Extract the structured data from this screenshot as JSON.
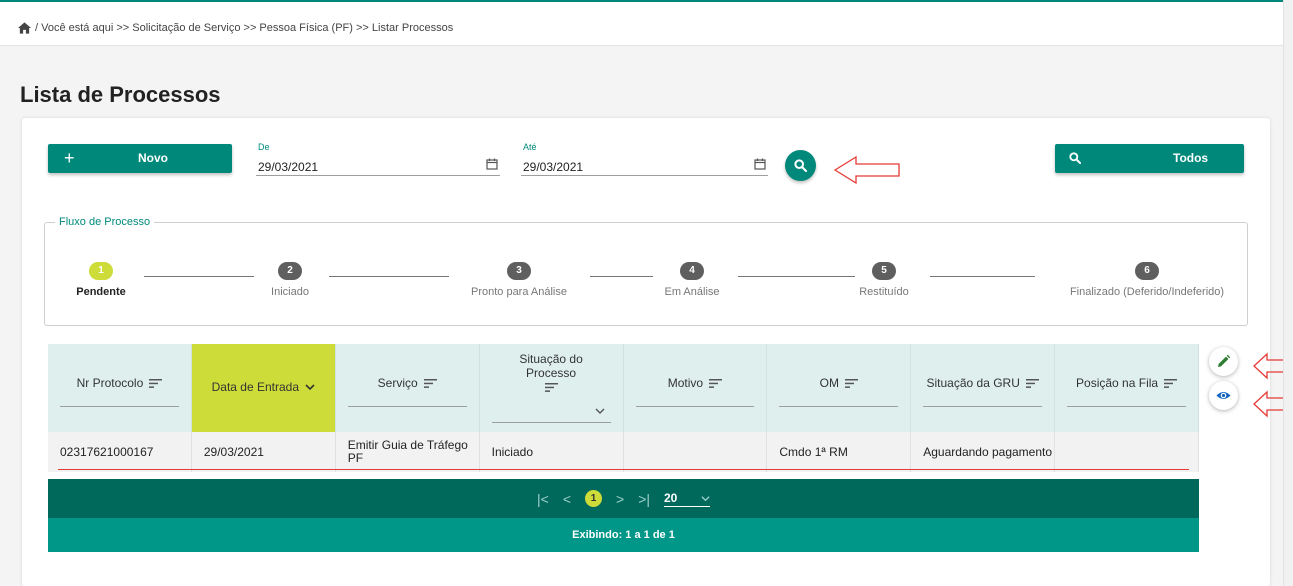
{
  "breadcrumb": {
    "text": "/ Você está aqui >> Solicitação de Serviço >> Pessoa Física (PF) >> Listar Processos",
    "icon": "home-icon"
  },
  "page": {
    "title": "Lista de Processos"
  },
  "toolbar": {
    "novo_icon": "+",
    "novo_label": "Novo",
    "todos_label": "Todos",
    "de_label": "De",
    "de_value": "29/03/2021",
    "ate_label": "Até",
    "ate_value": "29/03/2021"
  },
  "fluxo": {
    "legend": "Fluxo de Processo",
    "steps": [
      {
        "num": "1",
        "label": "Pendente",
        "active": true
      },
      {
        "num": "2",
        "label": "Iniciado",
        "active": false
      },
      {
        "num": "3",
        "label": "Pronto para Análise",
        "active": false
      },
      {
        "num": "4",
        "label": "Em Análise",
        "active": false
      },
      {
        "num": "5",
        "label": "Restituído",
        "active": false
      },
      {
        "num": "6",
        "label": "Finalizado (Deferido/Indeferido)",
        "active": false
      }
    ]
  },
  "table": {
    "columns": [
      {
        "label": "Nr Protocolo"
      },
      {
        "label": "Data de Entrada",
        "sorted": true
      },
      {
        "label": "Serviço"
      },
      {
        "label": "Situação do Processo"
      },
      {
        "label": "Motivo"
      },
      {
        "label": "OM"
      },
      {
        "label": "Situação da GRU"
      },
      {
        "label": "Posição na Fila"
      }
    ],
    "rows": [
      [
        "02317621000167",
        "29/03/2021",
        "Emitir Guia de Tráfego PF",
        "Iniciado",
        "",
        "Cmdo 1ª RM",
        "Aguardando pagamento",
        ""
      ]
    ]
  },
  "pagination": {
    "current_page": "1",
    "page_size": "20",
    "footer": "Exibindo: 1 a 1 de 1"
  },
  "colors": {
    "primary": "#00897b",
    "dark": "#00695c",
    "accent": "#cddc39",
    "annotation": "#e53935",
    "view_icon": "#1565c0"
  }
}
